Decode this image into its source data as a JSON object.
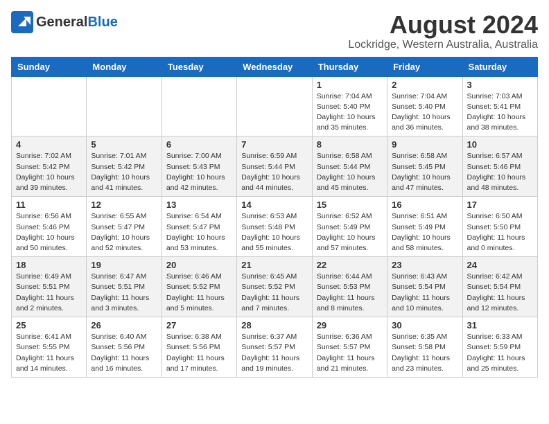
{
  "header": {
    "logo_general": "General",
    "logo_blue": "Blue",
    "month_title": "August 2024",
    "location": "Lockridge, Western Australia, Australia"
  },
  "days_of_week": [
    "Sunday",
    "Monday",
    "Tuesday",
    "Wednesday",
    "Thursday",
    "Friday",
    "Saturday"
  ],
  "weeks": [
    [
      {
        "day": "",
        "info": ""
      },
      {
        "day": "",
        "info": ""
      },
      {
        "day": "",
        "info": ""
      },
      {
        "day": "",
        "info": ""
      },
      {
        "day": "1",
        "info": "Sunrise: 7:04 AM\nSunset: 5:40 PM\nDaylight: 10 hours\nand 35 minutes."
      },
      {
        "day": "2",
        "info": "Sunrise: 7:04 AM\nSunset: 5:40 PM\nDaylight: 10 hours\nand 36 minutes."
      },
      {
        "day": "3",
        "info": "Sunrise: 7:03 AM\nSunset: 5:41 PM\nDaylight: 10 hours\nand 38 minutes."
      }
    ],
    [
      {
        "day": "4",
        "info": "Sunrise: 7:02 AM\nSunset: 5:42 PM\nDaylight: 10 hours\nand 39 minutes."
      },
      {
        "day": "5",
        "info": "Sunrise: 7:01 AM\nSunset: 5:42 PM\nDaylight: 10 hours\nand 41 minutes."
      },
      {
        "day": "6",
        "info": "Sunrise: 7:00 AM\nSunset: 5:43 PM\nDaylight: 10 hours\nand 42 minutes."
      },
      {
        "day": "7",
        "info": "Sunrise: 6:59 AM\nSunset: 5:44 PM\nDaylight: 10 hours\nand 44 minutes."
      },
      {
        "day": "8",
        "info": "Sunrise: 6:58 AM\nSunset: 5:44 PM\nDaylight: 10 hours\nand 45 minutes."
      },
      {
        "day": "9",
        "info": "Sunrise: 6:58 AM\nSunset: 5:45 PM\nDaylight: 10 hours\nand 47 minutes."
      },
      {
        "day": "10",
        "info": "Sunrise: 6:57 AM\nSunset: 5:46 PM\nDaylight: 10 hours\nand 48 minutes."
      }
    ],
    [
      {
        "day": "11",
        "info": "Sunrise: 6:56 AM\nSunset: 5:46 PM\nDaylight: 10 hours\nand 50 minutes."
      },
      {
        "day": "12",
        "info": "Sunrise: 6:55 AM\nSunset: 5:47 PM\nDaylight: 10 hours\nand 52 minutes."
      },
      {
        "day": "13",
        "info": "Sunrise: 6:54 AM\nSunset: 5:47 PM\nDaylight: 10 hours\nand 53 minutes."
      },
      {
        "day": "14",
        "info": "Sunrise: 6:53 AM\nSunset: 5:48 PM\nDaylight: 10 hours\nand 55 minutes."
      },
      {
        "day": "15",
        "info": "Sunrise: 6:52 AM\nSunset: 5:49 PM\nDaylight: 10 hours\nand 57 minutes."
      },
      {
        "day": "16",
        "info": "Sunrise: 6:51 AM\nSunset: 5:49 PM\nDaylight: 10 hours\nand 58 minutes."
      },
      {
        "day": "17",
        "info": "Sunrise: 6:50 AM\nSunset: 5:50 PM\nDaylight: 11 hours\nand 0 minutes."
      }
    ],
    [
      {
        "day": "18",
        "info": "Sunrise: 6:49 AM\nSunset: 5:51 PM\nDaylight: 11 hours\nand 2 minutes."
      },
      {
        "day": "19",
        "info": "Sunrise: 6:47 AM\nSunset: 5:51 PM\nDaylight: 11 hours\nand 3 minutes."
      },
      {
        "day": "20",
        "info": "Sunrise: 6:46 AM\nSunset: 5:52 PM\nDaylight: 11 hours\nand 5 minutes."
      },
      {
        "day": "21",
        "info": "Sunrise: 6:45 AM\nSunset: 5:52 PM\nDaylight: 11 hours\nand 7 minutes."
      },
      {
        "day": "22",
        "info": "Sunrise: 6:44 AM\nSunset: 5:53 PM\nDaylight: 11 hours\nand 8 minutes."
      },
      {
        "day": "23",
        "info": "Sunrise: 6:43 AM\nSunset: 5:54 PM\nDaylight: 11 hours\nand 10 minutes."
      },
      {
        "day": "24",
        "info": "Sunrise: 6:42 AM\nSunset: 5:54 PM\nDaylight: 11 hours\nand 12 minutes."
      }
    ],
    [
      {
        "day": "25",
        "info": "Sunrise: 6:41 AM\nSunset: 5:55 PM\nDaylight: 11 hours\nand 14 minutes."
      },
      {
        "day": "26",
        "info": "Sunrise: 6:40 AM\nSunset: 5:56 PM\nDaylight: 11 hours\nand 16 minutes."
      },
      {
        "day": "27",
        "info": "Sunrise: 6:38 AM\nSunset: 5:56 PM\nDaylight: 11 hours\nand 17 minutes."
      },
      {
        "day": "28",
        "info": "Sunrise: 6:37 AM\nSunset: 5:57 PM\nDaylight: 11 hours\nand 19 minutes."
      },
      {
        "day": "29",
        "info": "Sunrise: 6:36 AM\nSunset: 5:57 PM\nDaylight: 11 hours\nand 21 minutes."
      },
      {
        "day": "30",
        "info": "Sunrise: 6:35 AM\nSunset: 5:58 PM\nDaylight: 11 hours\nand 23 minutes."
      },
      {
        "day": "31",
        "info": "Sunrise: 6:33 AM\nSunset: 5:59 PM\nDaylight: 11 hours\nand 25 minutes."
      }
    ]
  ]
}
